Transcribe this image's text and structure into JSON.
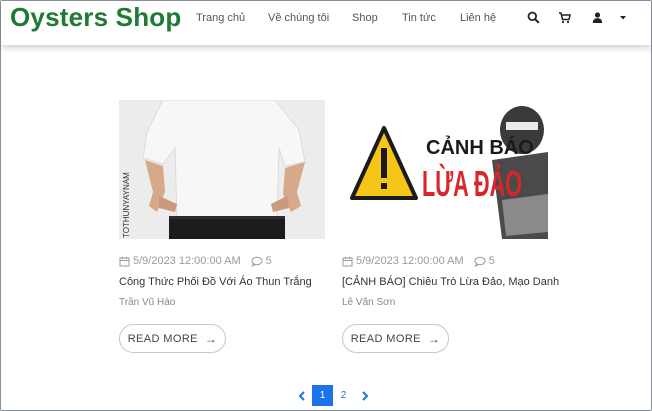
{
  "header": {
    "logo": "Oysters Shop",
    "nav": [
      "Trang chủ",
      "Về chúng tôi",
      "Shop",
      "Tin tức",
      "Liên hệ"
    ]
  },
  "posts": [
    {
      "date": "5/9/2023 12:00:00 AM",
      "comments": "5",
      "title": "Công Thức Phối Đồ Với Áo Thun Trắng",
      "author": "Trần Vũ Hào",
      "read_more": "READ MORE",
      "image_caption": "TOTHUNYAYNAM"
    },
    {
      "date": "5/9/2023 12:00:00 AM",
      "comments": "5",
      "title": "[CẢNH BÁO] Chiêu Trò Lừa Đảo, Mạo Danh",
      "author": "Lê Văn Sơn",
      "read_more": "READ MORE",
      "image_line1": "CẢNH BÁO",
      "image_line2": "LỪA ĐẢO"
    }
  ],
  "pagination": {
    "prev": "‹",
    "pages": [
      "1",
      "2"
    ],
    "next": "›",
    "current": "1"
  },
  "colors": {
    "brand": "#1f7a35",
    "accent": "#1a73e8",
    "warning_red": "#d8262a",
    "warning_yellow": "#f5c518"
  }
}
